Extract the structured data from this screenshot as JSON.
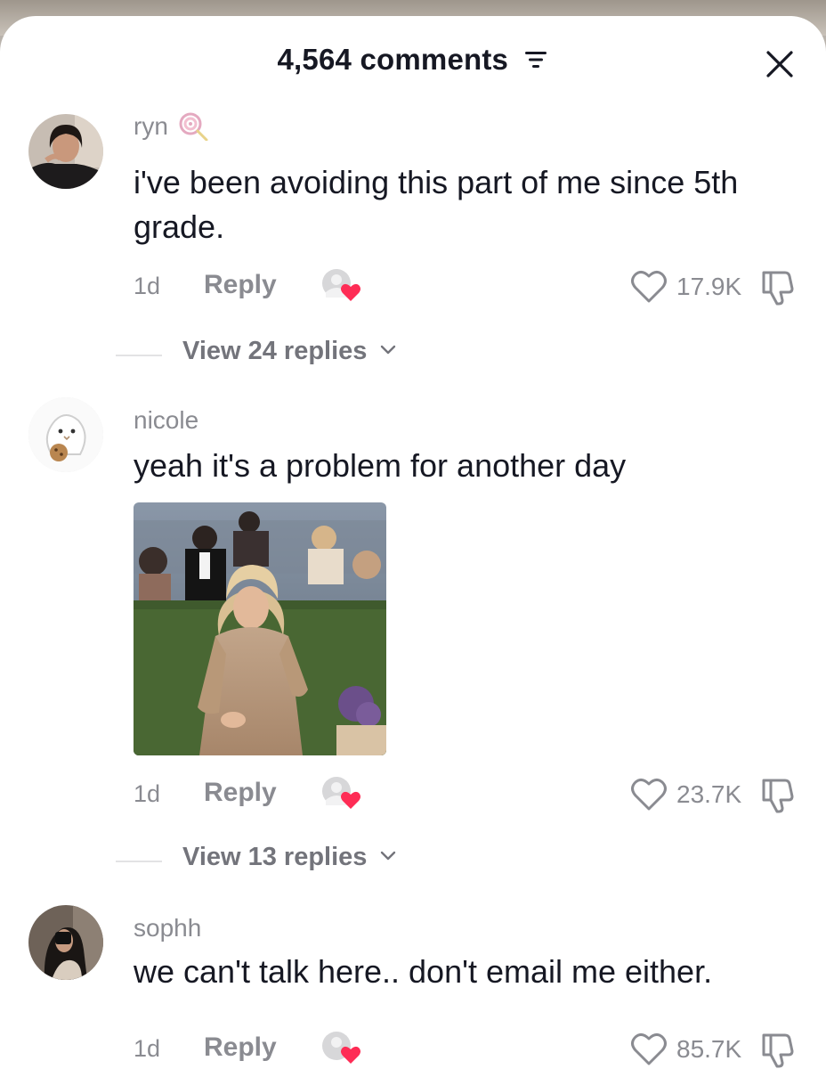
{
  "header": {
    "title": "4,564 comments"
  },
  "comments": [
    {
      "username": "ryn",
      "username_emoji": "lollipop-icon",
      "text": "i've been avoiding this part of me since 5th grade.",
      "time": "1d",
      "reply_label": "Reply",
      "likes": "17.9K",
      "view_replies": "View 24 replies"
    },
    {
      "username": "nicole",
      "text": "yeah it's a problem for another day",
      "has_image": true,
      "time": "1d",
      "reply_label": "Reply",
      "likes": "23.7K",
      "view_replies": "View 13 replies"
    },
    {
      "username": "sophh",
      "text": "we can't talk here.. don't email me either.",
      "time": "1d",
      "reply_label": "Reply",
      "likes": "85.7K"
    }
  ],
  "colors": {
    "text_primary": "#161823",
    "text_secondary": "#8a8b91",
    "heart_accent": "#fe2c55"
  },
  "icons": [
    "filter-icon",
    "close-icon",
    "heart-outline-icon",
    "dislike-icon",
    "chevron-down-icon",
    "creator-liked-icon"
  ]
}
